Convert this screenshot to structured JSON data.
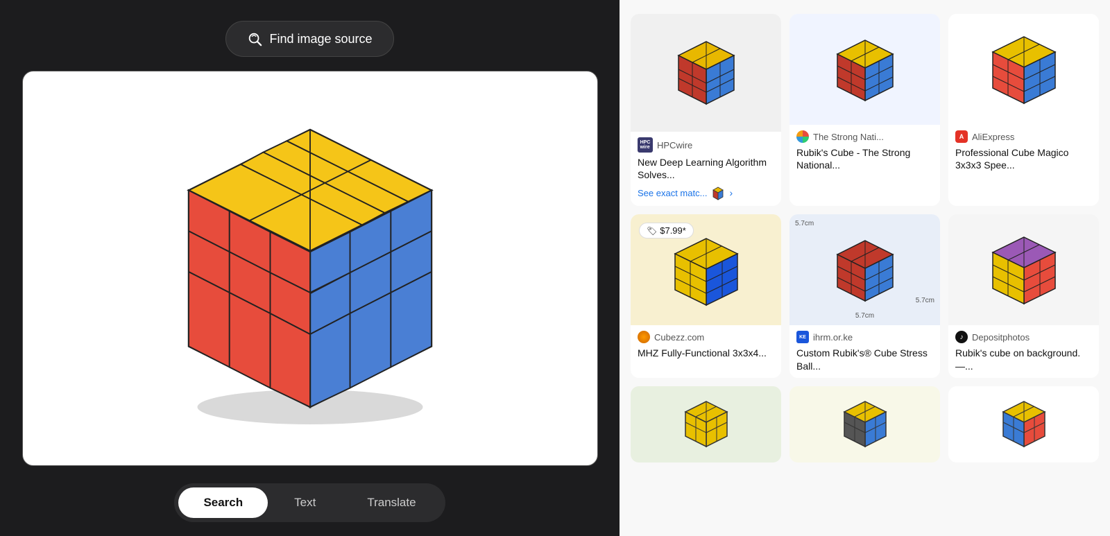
{
  "left": {
    "find_image_label": "Find image source",
    "tabs": [
      {
        "id": "search",
        "label": "Search",
        "active": true
      },
      {
        "id": "text",
        "label": "Text",
        "active": false
      },
      {
        "id": "translate",
        "label": "Translate",
        "active": false
      }
    ]
  },
  "right": {
    "results": [
      {
        "id": "hpcwire",
        "source": "HPCwire",
        "favicon_type": "hpcwire",
        "title": "New Deep Learning Algorithm Solves...",
        "see_matches": "See exact matc...",
        "has_matches": true
      },
      {
        "id": "strong-national",
        "source": "The Strong Nati...",
        "favicon_type": "globe-multi",
        "title": "Rubik's Cube - The Strong National...",
        "has_matches": false
      },
      {
        "id": "aliexpress",
        "source": "AliExpress",
        "favicon_type": "aliexpress",
        "title": "Professional Cube Magico 3x3x3 Spee...",
        "has_matches": false
      },
      {
        "id": "cubezz",
        "source": "Cubezz.com",
        "favicon_type": "cubezz",
        "price": "$7.99*",
        "title": "MHZ Fully-Functional 3x3x4...",
        "has_matches": false
      },
      {
        "id": "ihrm",
        "source": "ihrm.or.ke",
        "favicon_type": "ihrm",
        "dimension": "5.7cm",
        "title": "Custom Rubik's® Cube Stress Ball...",
        "has_matches": false
      },
      {
        "id": "depositphotos",
        "source": "Depositphotos",
        "favicon_type": "deposit",
        "title": "Rubik's cube on background. —...",
        "has_matches": false
      }
    ]
  }
}
